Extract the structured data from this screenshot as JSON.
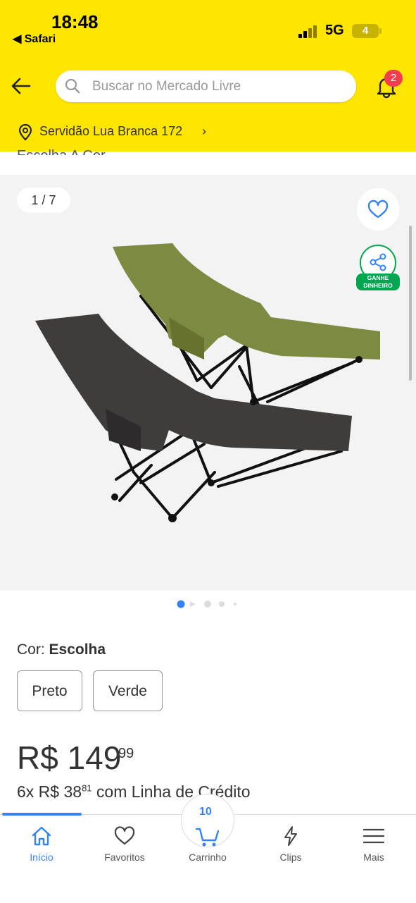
{
  "status_bar": {
    "time": "18:48",
    "back_app": "◀ Safari",
    "network": "5G",
    "battery": "4"
  },
  "search": {
    "placeholder": "Buscar no Mercado Livre"
  },
  "notifications": {
    "count": "2"
  },
  "location": {
    "address": "Servidão Lua Branca 172",
    "chevron": "›"
  },
  "cut_text": "Escolha A Cor",
  "gallery": {
    "counter": "1 / 7",
    "share_label_line1": "GANHE",
    "share_label_line2": "DINHEIRO"
  },
  "variation": {
    "label": "Cor:",
    "selected": "Escolha",
    "options": [
      "Preto",
      "Verde"
    ]
  },
  "price": {
    "currency_int": "R$ 149",
    "cents": "99"
  },
  "installments": {
    "prefix": "6x R$ 38",
    "cents": "81",
    "suffix": " com Linha de Crédito"
  },
  "tabbar": {
    "items": [
      {
        "label": "Início"
      },
      {
        "label": "Favoritos"
      },
      {
        "label": "Carrinho"
      },
      {
        "label": "Clips"
      },
      {
        "label": "Mais"
      }
    ],
    "cart_count": "10"
  },
  "colors": {
    "header_yellow": "#FFE600",
    "accent_blue": "#3483FA",
    "badge_red": "#F23D4F",
    "green": "#00a650"
  }
}
